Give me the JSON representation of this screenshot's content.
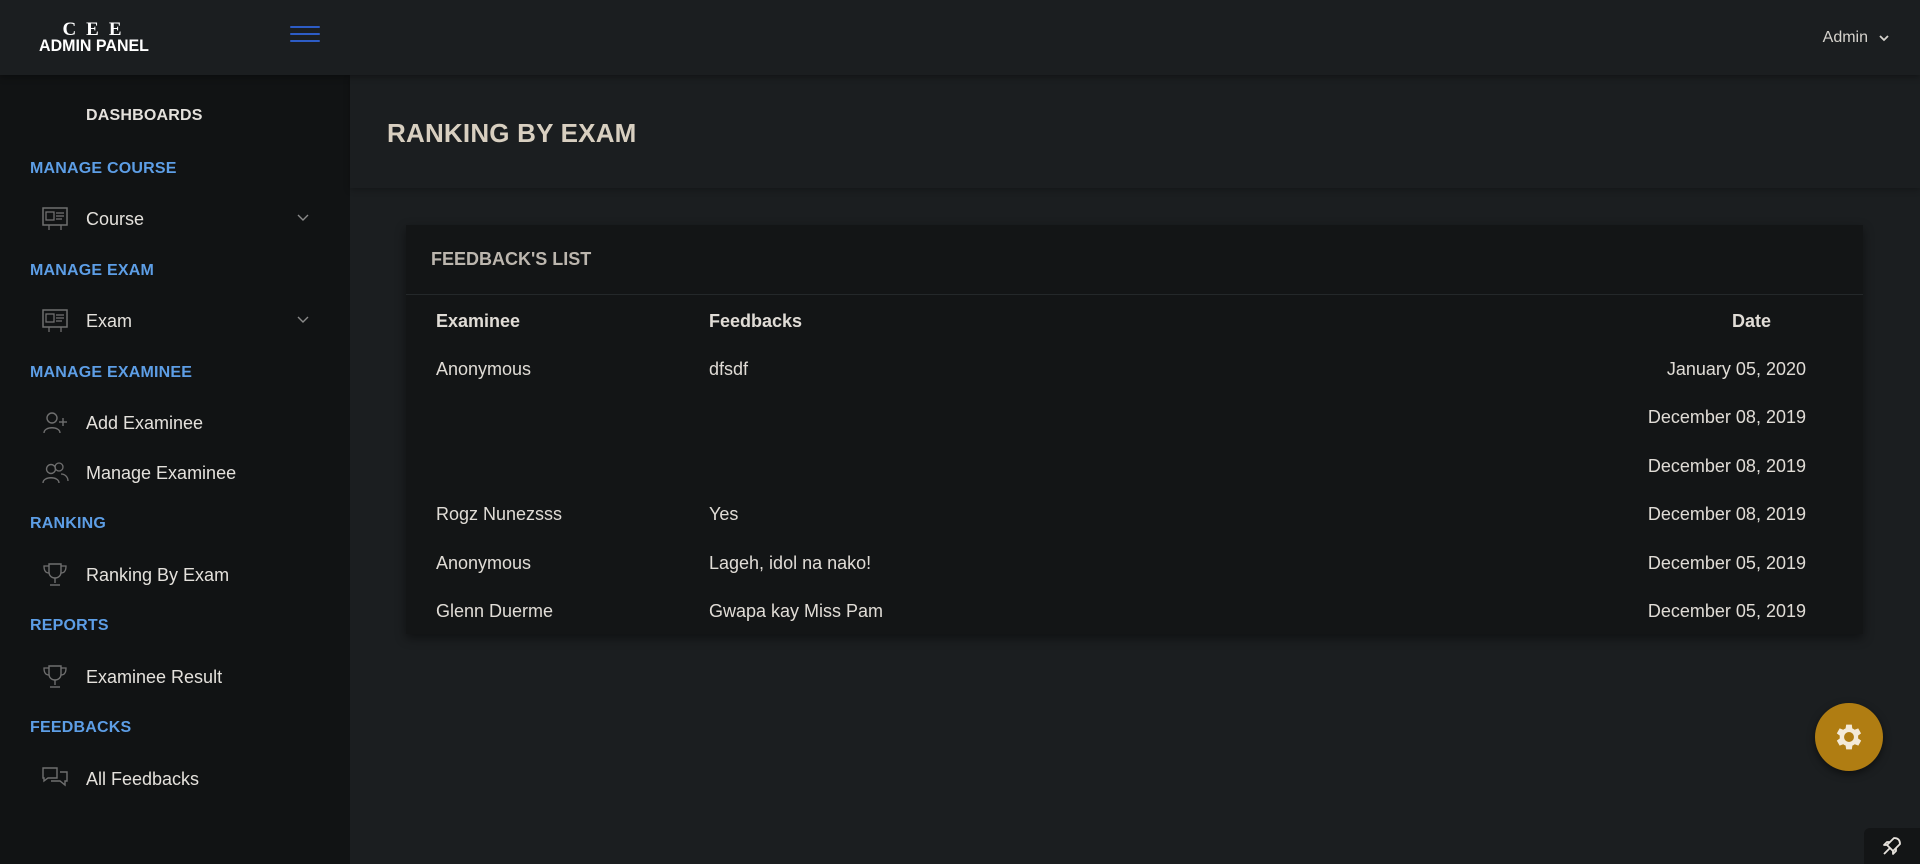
{
  "brand": {
    "line1": "CEE",
    "line2": "ADMIN PANEL"
  },
  "header": {
    "user": "Admin"
  },
  "sidebar": {
    "dashboards": "DASHBOARDS",
    "sections": [
      {
        "title": "MANAGE COURSE",
        "items": [
          {
            "label": "Course",
            "icon": "presentation-board-icon",
            "expandable": true
          }
        ]
      },
      {
        "title": "MANAGE EXAM",
        "items": [
          {
            "label": "Exam",
            "icon": "presentation-board-icon",
            "expandable": true
          }
        ]
      },
      {
        "title": "MANAGE EXAMINEE",
        "items": [
          {
            "label": "Add Examinee",
            "icon": "add-user-icon"
          },
          {
            "label": "Manage Examinee",
            "icon": "users-icon"
          }
        ]
      },
      {
        "title": "RANKING",
        "items": [
          {
            "label": "Ranking By Exam",
            "icon": "trophy-icon"
          }
        ]
      },
      {
        "title": "REPORTS",
        "items": [
          {
            "label": "Examinee Result",
            "icon": "trophy-icon"
          }
        ]
      },
      {
        "title": "FEEDBACKS",
        "items": [
          {
            "label": "All Feedbacks",
            "icon": "chat-bubbles-icon"
          }
        ]
      }
    ]
  },
  "page": {
    "title": "RANKING BY EXAM"
  },
  "card": {
    "title": "FEEDBACK'S LIST",
    "columns": {
      "examinee": "Examinee",
      "feedbacks": "Feedbacks",
      "date": "Date"
    },
    "rows": [
      {
        "examinee": "Anonymous",
        "feedback": "dfsdf",
        "date": "January 05, 2020"
      },
      {
        "examinee": "",
        "feedback": "",
        "date": "December 08, 2019"
      },
      {
        "examinee": "",
        "feedback": "",
        "date": "December 08, 2019"
      },
      {
        "examinee": "Rogz Nunezsss",
        "feedback": "Yes",
        "date": "December 08, 2019"
      },
      {
        "examinee": "Anonymous",
        "feedback": "Lageh, idol na nako!",
        "date": "December 05, 2019"
      },
      {
        "examinee": "Glenn Duerme",
        "feedback": "Gwapa kay Miss Pam",
        "date": "December 05, 2019"
      }
    ]
  },
  "colors": {
    "accent_blue": "#5d9ee6",
    "hamburger_blue": "#2d5cc5",
    "gear_fab": "#b07d12",
    "sidebar_bg": "#111314",
    "main_bg": "#1b1e20"
  }
}
